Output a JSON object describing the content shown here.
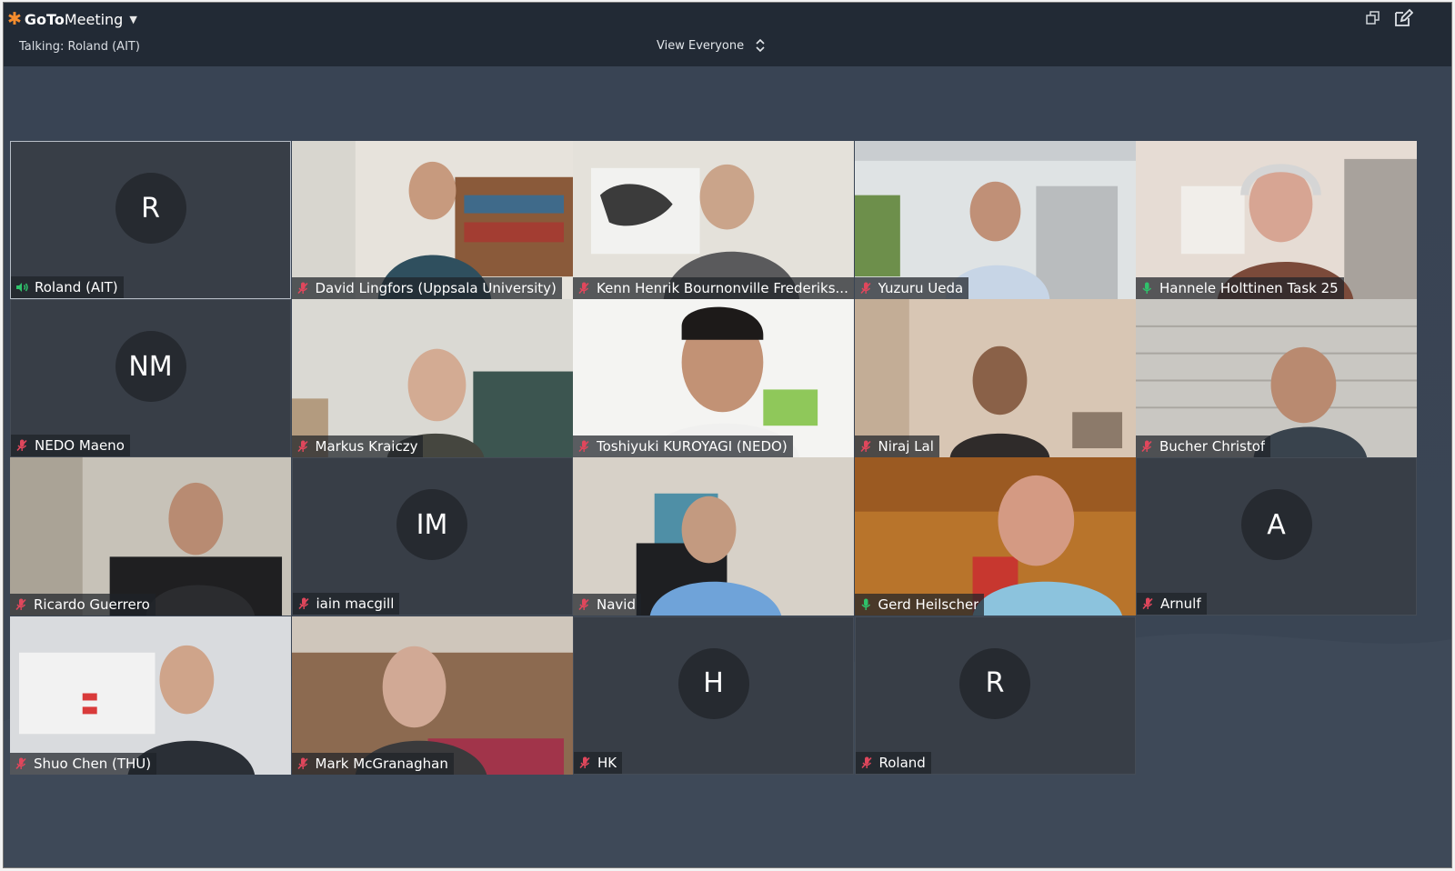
{
  "app": {
    "name_bold": "GoTo",
    "name_rest": "Meeting",
    "talking": "Talking: Roland (AIT)",
    "view_selector": "View Everyone"
  },
  "colors": {
    "brand_orange": "#f68d2e",
    "stage_bg": "#3a4554",
    "tile_bg": "#383e47",
    "muted_red": "#e0475c",
    "live_green": "#2fc26b"
  },
  "participants": [
    {
      "name": "Roland (AIT)",
      "initials": "R",
      "video": false,
      "mic": "speaking",
      "active": true
    },
    {
      "name": "David Lingfors (Uppsala University)",
      "video": true,
      "mic": "muted",
      "scene": "bookshelf"
    },
    {
      "name": "Kenn Henrik Bournonville Frederiks...",
      "video": true,
      "mic": "muted",
      "scene": "worldmap"
    },
    {
      "name": "Yuzuru Ueda",
      "video": true,
      "mic": "muted",
      "scene": "office"
    },
    {
      "name": "Hannele Holttinen Task 25",
      "video": true,
      "mic": "live",
      "scene": "headset"
    },
    {
      "name": "NEDO Maeno",
      "initials": "NM",
      "video": false,
      "mic": "muted"
    },
    {
      "name": "Markus Kraiczy",
      "video": true,
      "mic": "muted",
      "scene": "forest"
    },
    {
      "name": "Toshiyuki KUROYAGI (NEDO)",
      "video": true,
      "mic": "muted",
      "scene": "white"
    },
    {
      "name": "Niraj Lal",
      "video": true,
      "mic": "muted",
      "scene": "warm"
    },
    {
      "name": "Bucher Christof",
      "video": true,
      "mic": "muted",
      "scene": "brick"
    },
    {
      "name": "Ricardo Guerrero",
      "video": true,
      "mic": "muted",
      "scene": "chair"
    },
    {
      "name": "iain macgill",
      "initials": "IM",
      "video": false,
      "mic": "muted"
    },
    {
      "name": "Navid",
      "video": true,
      "mic": "muted",
      "scene": "room"
    },
    {
      "name": "Gerd Heilscher",
      "video": true,
      "mic": "live",
      "scene": "wood"
    },
    {
      "name": "Arnulf",
      "initials": "A",
      "video": false,
      "mic": "muted"
    },
    {
      "name": "Shuo Chen (THU)",
      "video": true,
      "mic": "muted",
      "scene": "calendar"
    },
    {
      "name": "Mark McGranaghan",
      "video": true,
      "mic": "muted",
      "scene": "lounge"
    },
    {
      "name": "HK",
      "initials": "H",
      "video": false,
      "mic": "muted"
    },
    {
      "name": "Roland",
      "initials": "R",
      "video": false,
      "mic": "muted"
    }
  ]
}
